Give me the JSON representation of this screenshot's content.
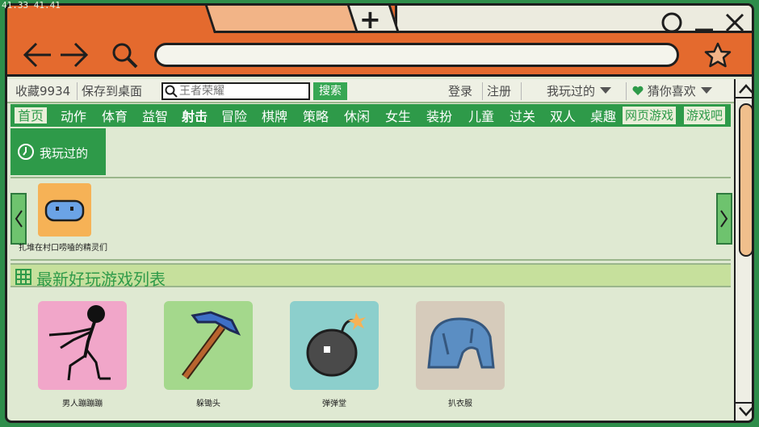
{
  "overlay": {
    "fps": "41.33    41.41"
  },
  "browser": {
    "new_tab": "+",
    "window_controls": {
      "maximize": "○",
      "minimize": "—",
      "close": "✕"
    },
    "icons": {
      "back": "arrow-left-icon",
      "forward": "arrow-right-icon",
      "search": "magnifier-icon",
      "favorite": "star-icon"
    }
  },
  "toolbar": {
    "favorites": "收藏9934",
    "save_desktop": "保存到桌面",
    "search_placeholder": "王者荣耀",
    "search_button": "搜索",
    "login": "登录",
    "register": "注册",
    "played_menu": "我玩过的",
    "guess_menu": "猜你喜欢"
  },
  "categories": {
    "home": "首页",
    "items": [
      "动作",
      "体育",
      "益智",
      "射击",
      "冒险",
      "棋牌",
      "策略",
      "休闲",
      "女生",
      "装扮",
      "儿童",
      "过关",
      "双人",
      "桌趣"
    ],
    "web_games": "网页游戏",
    "game_bar": "游戏吧"
  },
  "recent": {
    "tab_label": "我玩过的",
    "items": [
      {
        "label": "扎堆在村口唠嗑的精灵们"
      }
    ]
  },
  "latest": {
    "title": "最新好玩游戏列表",
    "games": [
      {
        "label": "男人蹦蹦蹦"
      },
      {
        "label": "躲锄头"
      },
      {
        "label": "弹弹堂"
      },
      {
        "label": "扒衣服"
      }
    ]
  },
  "colors": {
    "chrome_orange": "#e46a2e",
    "accent_green": "#2e9a49",
    "section_green": "#c6e09c",
    "page_bg": "#dfe9d2"
  }
}
